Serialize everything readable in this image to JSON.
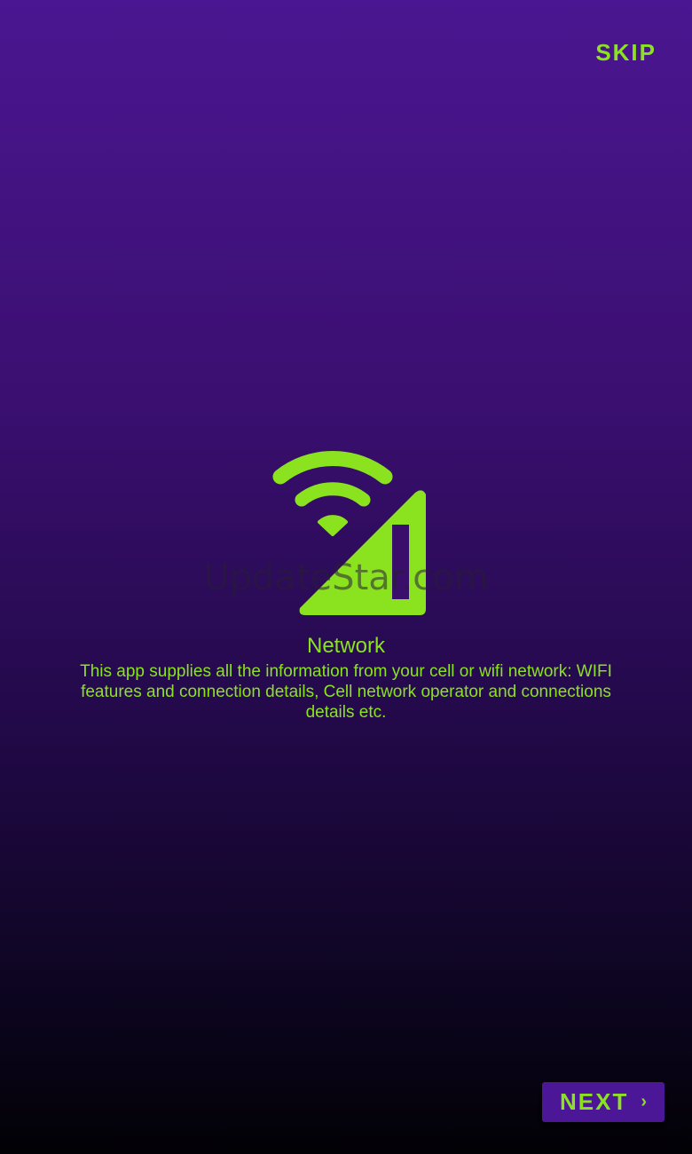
{
  "header": {
    "skip_label": "SKIP"
  },
  "slide": {
    "icon": "wifi-cell-signal-icon",
    "title": "Network",
    "description": "This app supplies all the information from your cell or wifi network: WIFI features and connection details, Cell network operator and connections details etc."
  },
  "watermark": {
    "text": "UpdateStar.com"
  },
  "footer": {
    "next_label": "NEXT",
    "next_icon": "chevron-right-icon"
  },
  "colors": {
    "accent": "#8be31f",
    "button_bg": "#4b1796",
    "background_top": "#4b1691",
    "background_bottom": "#020105"
  }
}
